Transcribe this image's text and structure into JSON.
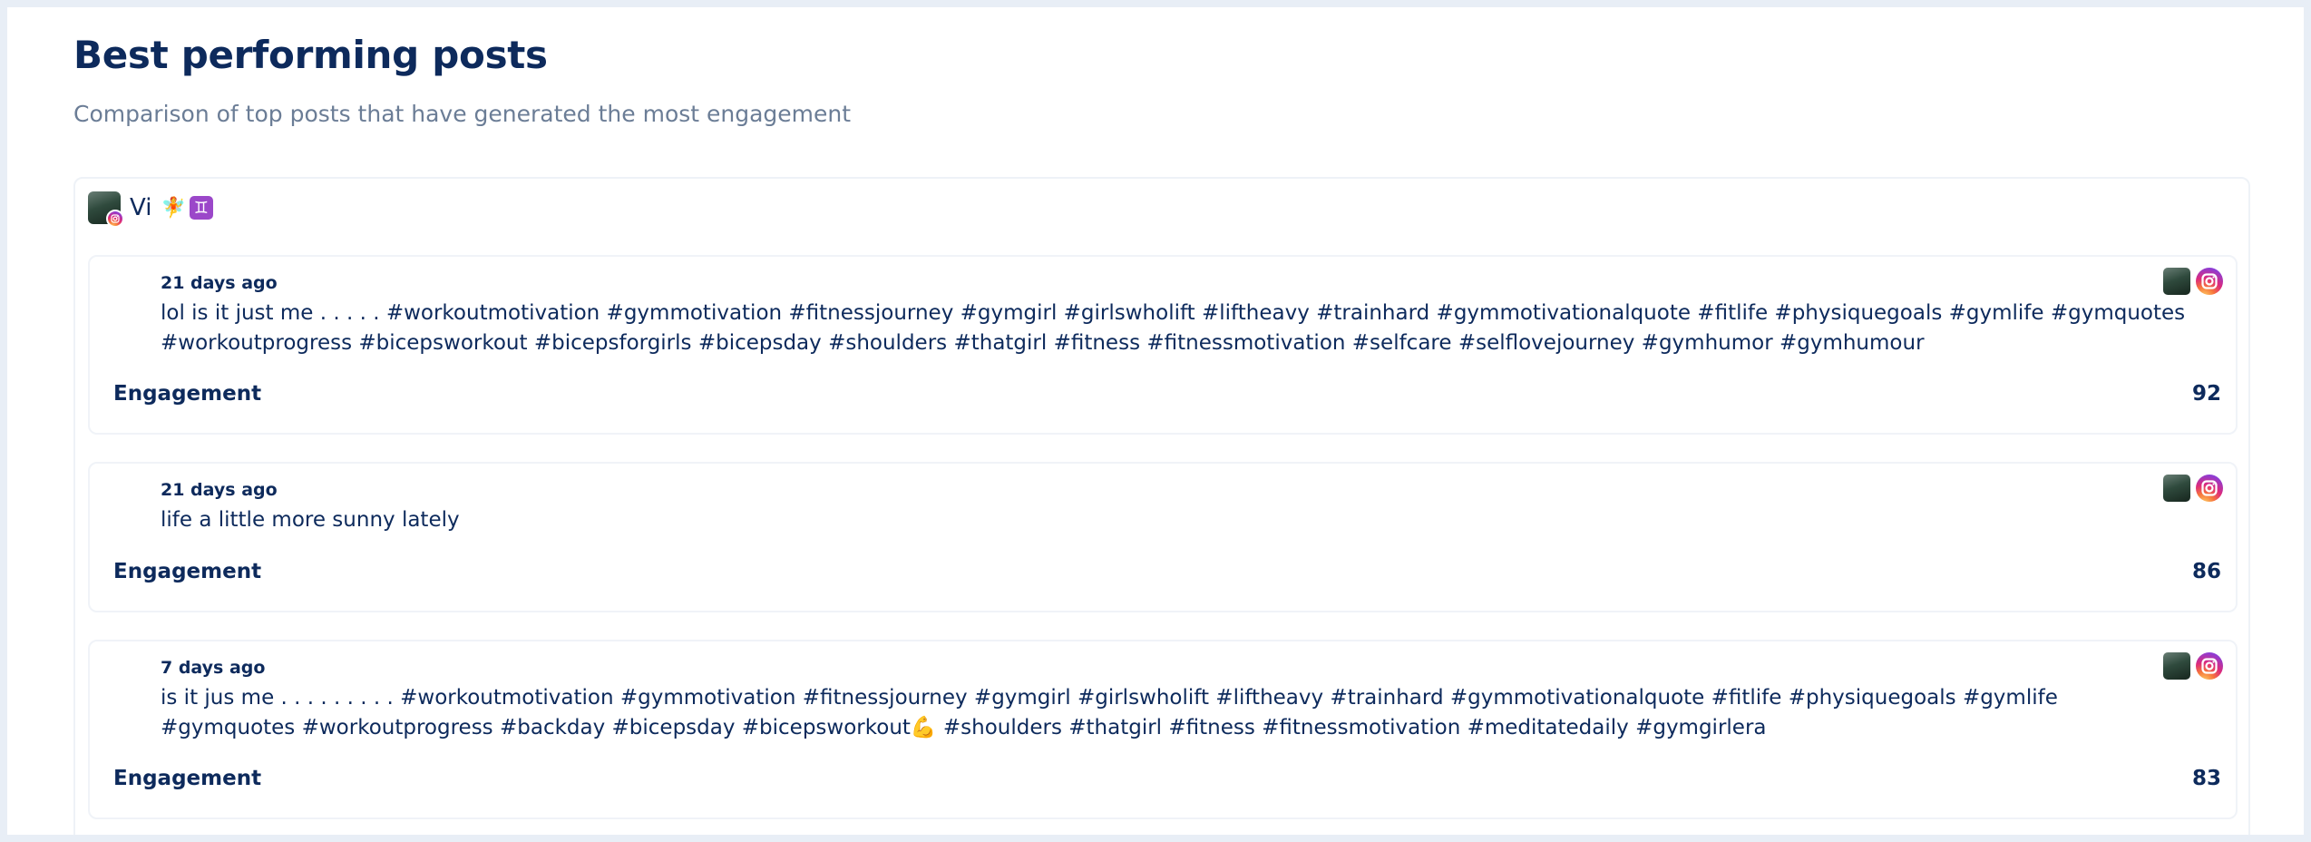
{
  "header": {
    "title": "Best performing posts",
    "subtitle": "Comparison of top posts that have generated the most engagement"
  },
  "account": {
    "name": "Vi",
    "emoji_1": "🧚",
    "emoji_2": "♊",
    "network": "instagram-icon"
  },
  "engagement_label": "Engagement",
  "posts": [
    {
      "time": "21 days ago",
      "text": "lol is it just me . . . . . #workoutmotivation #gymmotivation #fitnessjourney #gymgirl #girlswholift #liftheavy #trainhard #gymmotivationalquote #fitlife #physiquegoals #gymlife #gymquotes #workoutprogress #bicepsworkout #bicepsforgirls #bicepsday #shoulders #thatgirl #fitness #fitnessmotivation #selfcare #selflovejourney #gymhumor #gymhumour",
      "engagement": "92"
    },
    {
      "time": "21 days ago",
      "text": "life a little more sunny lately",
      "engagement": "86"
    },
    {
      "time": "7 days ago",
      "text": "is it jus me . . . . . . . . . #workoutmotivation #gymmotivation #fitnessjourney #gymgirl #girlswholift #liftheavy #trainhard #gymmotivationalquote #fitlife #physiquegoals #gymlife #gymquotes #workoutprogress #backday #bicepsday #bicepsworkout💪 #shoulders #thatgirl #fitness #fitnessmotivation #meditatedaily #gymgirlera",
      "engagement": "83"
    }
  ],
  "colors": {
    "text_primary": "#0d2a5c",
    "text_secondary": "#6b7d96",
    "background": "#e8eef6"
  }
}
